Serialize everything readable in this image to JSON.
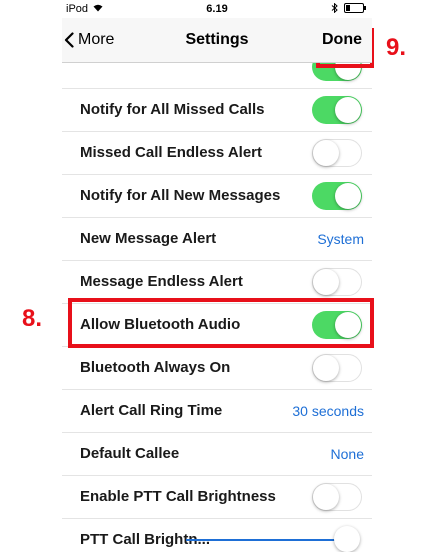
{
  "status_bar": {
    "carrier": "iPod",
    "wifi_icon": "wifi-icon",
    "time": "6.19",
    "bluetooth_icon": "bluetooth-icon",
    "battery_icon": "battery-icon"
  },
  "nav": {
    "back_label": "More",
    "back_icon": "chevron-left-icon",
    "title": "Settings",
    "done_label": "Done"
  },
  "rows": [
    {
      "label": "Notify for All Missed Calls",
      "control": "toggle",
      "on": true
    },
    {
      "label": "Missed Call Endless Alert",
      "control": "toggle",
      "on": false
    },
    {
      "label": "Notify for All New Messages",
      "control": "toggle",
      "on": true
    },
    {
      "label": "New Message Alert",
      "control": "value",
      "value": "System"
    },
    {
      "label": "Message Endless Alert",
      "control": "toggle",
      "on": false
    },
    {
      "label": "Allow Bluetooth Audio",
      "control": "toggle",
      "on": true
    },
    {
      "label": "Bluetooth Always On",
      "control": "toggle",
      "on": false
    },
    {
      "label": "Alert Call Ring Time",
      "control": "value",
      "value": "30 seconds"
    },
    {
      "label": "Default Callee",
      "control": "value",
      "value": "None"
    },
    {
      "label": "Enable PTT Call Brightness",
      "control": "toggle",
      "on": false
    },
    {
      "label": "PTT Call Brightn...",
      "control": "slider",
      "level": 1.0
    }
  ],
  "annotations": {
    "done_marker": "9.",
    "bluetooth_marker": "8.",
    "color": "#e8101a"
  },
  "colors": {
    "toggle_on": "#4cd964",
    "link_blue": "#1e6fd6"
  }
}
